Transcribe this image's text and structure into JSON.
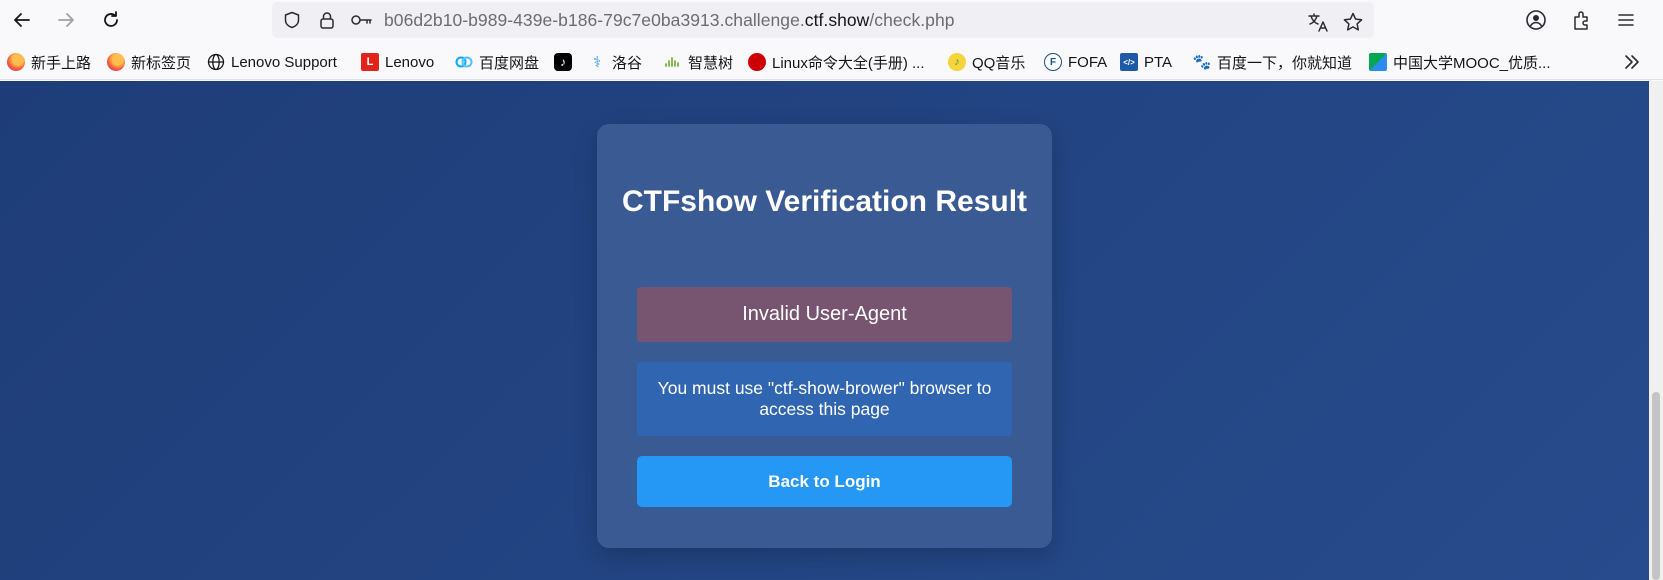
{
  "browser": {
    "url_prefix": "b06d2b10-b989-439e-b186-79c7e0ba3913.challenge.",
    "url_domain": "ctf.show",
    "url_path": "/check.php",
    "nav": {
      "back_icon": "back-arrow-icon",
      "forward_icon": "forward-arrow-icon",
      "reload_icon": "reload-icon"
    }
  },
  "bookmarks": [
    {
      "label": "新手上路",
      "icon": "firefox-icon",
      "color": "#e66000"
    },
    {
      "label": "新标签页",
      "icon": "firefox-icon",
      "color": "#e66000"
    },
    {
      "label": "Lenovo Support",
      "icon": "globe-icon",
      "color": "#ffffff"
    },
    {
      "label": "Lenovo",
      "icon": "lenovo-icon",
      "color": "#e2231a"
    },
    {
      "label": "百度网盘",
      "icon": "baidu-netdisk-icon",
      "color": "#06a7ff"
    },
    {
      "label": "",
      "icon": "tiktok-icon",
      "color": "#000000"
    },
    {
      "label": "洛谷",
      "icon": "luogu-icon",
      "color": "#3498db"
    },
    {
      "label": "智慧树",
      "icon": "zhihuishu-icon",
      "color": "#7cb342"
    },
    {
      "label": "Linux命令大全(手册) ...",
      "icon": "redhat-icon",
      "color": "#cc0000"
    },
    {
      "label": "QQ音乐",
      "icon": "qqmusic-icon",
      "color": "#31c27c"
    },
    {
      "label": "FOFA",
      "icon": "fofa-icon",
      "color": "#1a4f8b"
    },
    {
      "label": "PTA",
      "icon": "pta-icon",
      "color": "#1e5aa8"
    },
    {
      "label": "百度一下，你就知道",
      "icon": "baidu-icon",
      "color": "#2932e1"
    },
    {
      "label": "中国大学MOOC_优质...",
      "icon": "mooc-icon",
      "color": "#00a854"
    }
  ],
  "card": {
    "title": "CTFshow Verification Result",
    "error_message": "Invalid User-Agent",
    "info_message": "You must use \"ctf-show-brower\" browser to access this page",
    "button_label": "Back to Login"
  },
  "colors": {
    "page_bg": "#1e3d78",
    "card_bg": "#3a5a93",
    "error_bg": "#77546f",
    "info_bg": "#3066b1",
    "button_bg": "#2597f4"
  }
}
